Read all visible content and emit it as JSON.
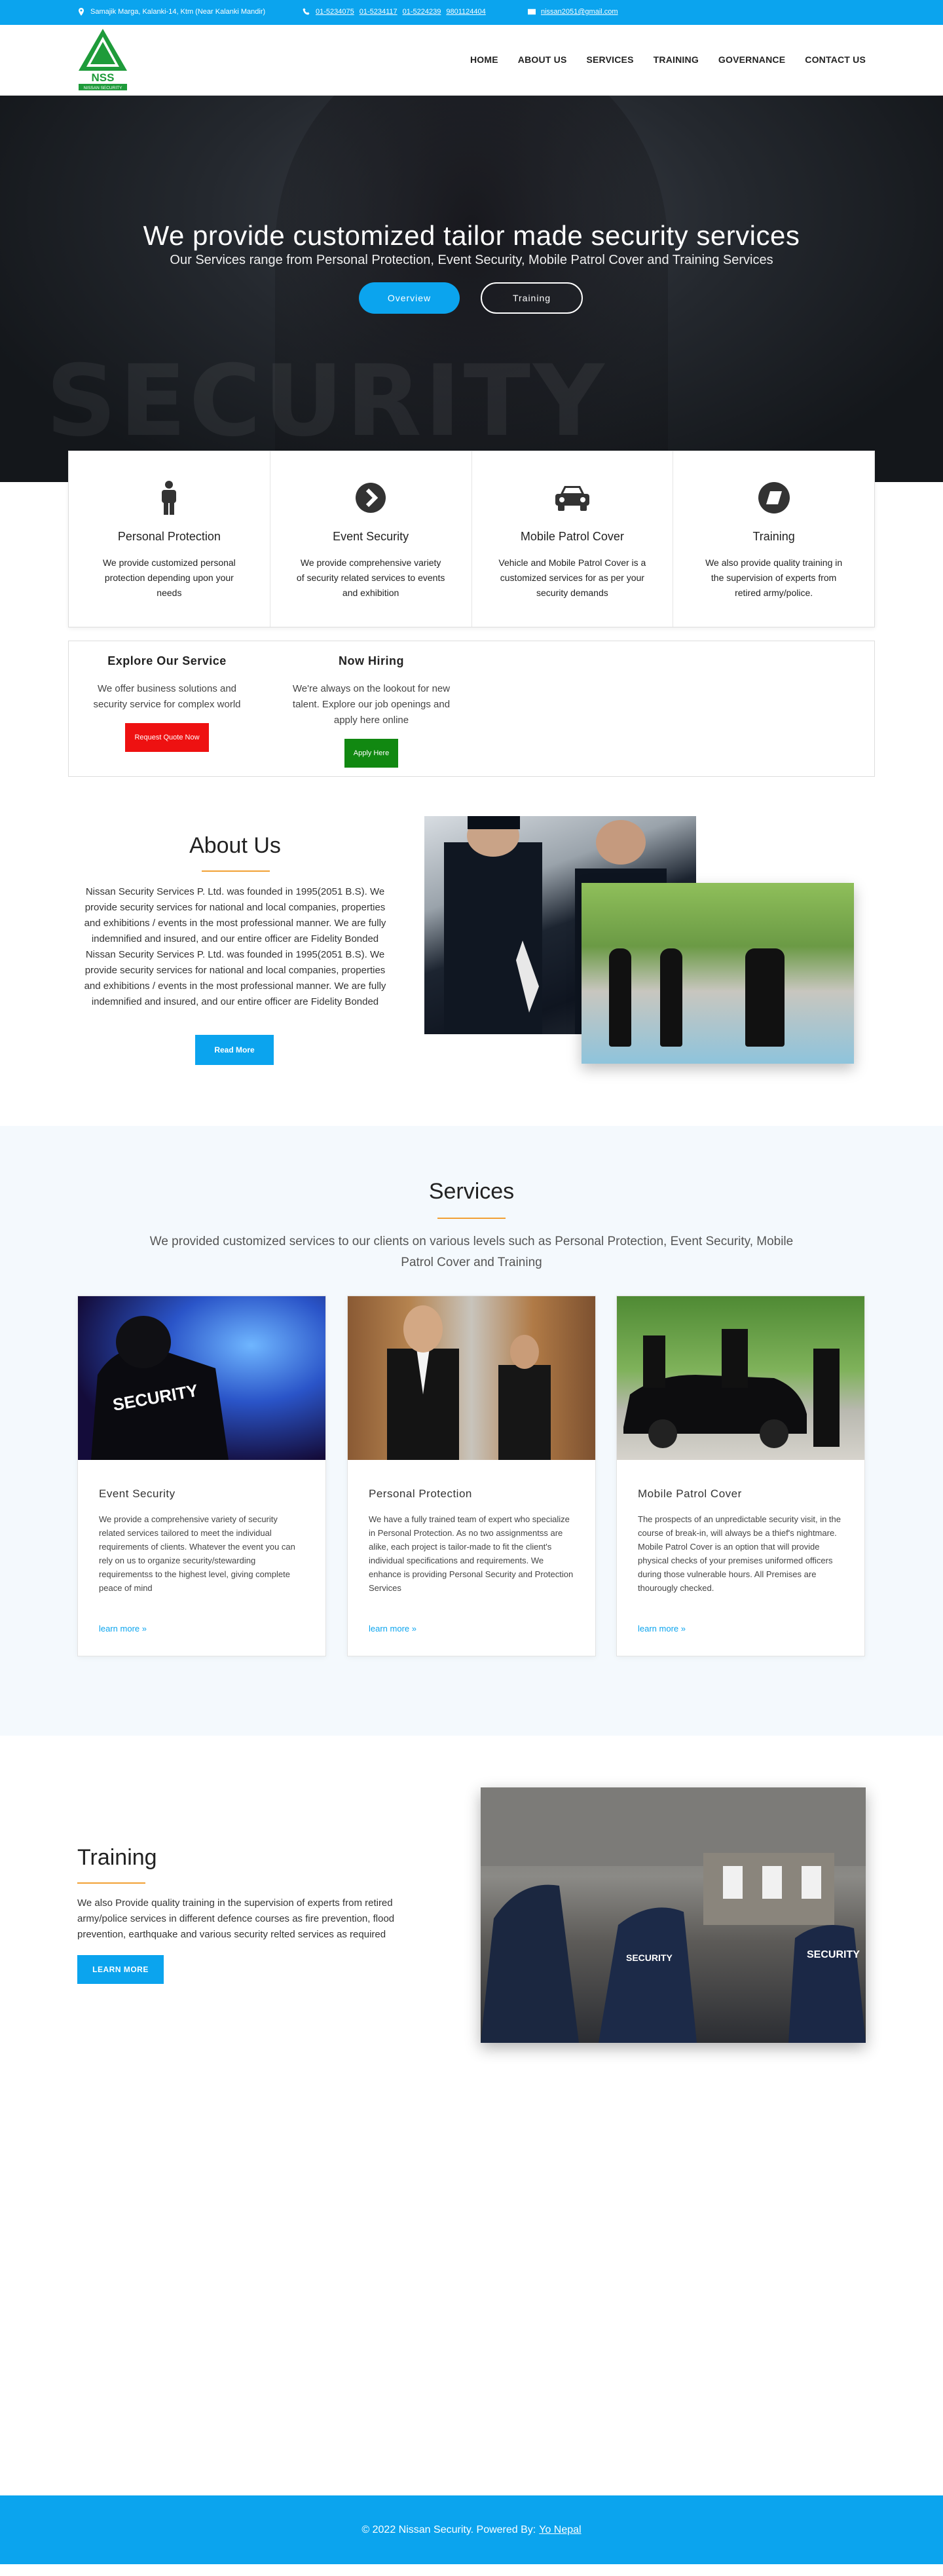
{
  "topbar": {
    "address": "Samajik Marga, Kalanki-14, Ktm (Near Kalanki Mandir)",
    "phones": [
      "01-5234075",
      "01-5234117",
      "01-5224239",
      "9801124404"
    ],
    "email": "nissan2051@gmail.com"
  },
  "logo": {
    "text": "NSS",
    "subtext": "NISSAN SECURITY"
  },
  "nav": [
    "HOME",
    "ABOUT US",
    "SERVICES",
    "TRAINING",
    "GOVERNANCE",
    "CONTACT US"
  ],
  "hero": {
    "title": "We provide customized tailor made security services",
    "subtitle": "Our Services range from Personal Protection, Event Security, Mobile Patrol Cover and Training Services",
    "overview_button": "Overview",
    "training_button": "Training",
    "background_text": "SECURITY"
  },
  "features": [
    {
      "icon": "person-icon",
      "title": "Personal Protection",
      "text": "We provide customized personal protection depending upon your needs"
    },
    {
      "icon": "chevron-circle-icon",
      "title": "Event Security",
      "text": "We provide comprehensive variety of security related services to events and exhibition"
    },
    {
      "icon": "car-icon",
      "title": "Mobile Patrol Cover",
      "text": "Vehicle and Mobile Patrol Cover is a customized services for as per your security demands"
    },
    {
      "icon": "eraser-icon",
      "title": "Training",
      "text": "We also provide quality training in the supervision of experts from retired army/police."
    }
  ],
  "explore": {
    "title": "Explore Our Service",
    "text": "We offer business solutions and security service for complex world",
    "button": "Request Quote Now",
    "button_color": "#ee1111"
  },
  "hiring": {
    "title": "Now Hiring",
    "text": "We're always on the lookout for new talent. Explore our job openings and apply here online",
    "button": "Apply Here",
    "button_color": "#118811"
  },
  "about": {
    "title": "About Us",
    "text": "Nissan Security Services P. Ltd. was founded in 1995(2051 B.S). We provide security services for national and local companies, properties and exhibitions / events in the most professional manner. We are fully indemnified and insured, and our entire officer are Fidelity Bonded Nissan Security Services P. Ltd. was founded in 1995(2051 B.S). We provide security services for national and local companies, properties and exhibitions / events in the most professional manner. We are fully indemnified and insured, and our entire officer are Fidelity Bonded",
    "button": "Read More"
  },
  "services": {
    "title": "Services",
    "text": "We provided customized services to our clients on various levels such as Personal Protection, Event Security, Mobile Patrol Cover and Training",
    "cards": [
      {
        "title": "Event Security",
        "image_text": "SECURITY",
        "text": "We provide a comprehensive variety of security related services tailored to meet the individual requirements of clients. Whatever the event you can rely on us to organize security/stewarding requirementss to the highest level, giving complete peace of mind",
        "link": "learn more"
      },
      {
        "title": "Personal Protection",
        "text": "We have a fully trained team of expert who specialize in Personal Protection. As no two assignmentss are alike, each project is tailor-made to fit the client's individual specifications and requirements. We enhance is providing Personal Security and Protection Services",
        "link": "learn more"
      },
      {
        "title": "Mobile Patrol Cover",
        "text": "The prospects of an unpredictable security visit, in the course of break-in, will always be a thief's nightmare. Mobile Patrol Cover is an option that will provide physical checks of your premises uniformed officers during those vulnerable hours.  All Premises are thourougly checked.",
        "link": "learn more"
      }
    ]
  },
  "training": {
    "title": "Training",
    "text": "We also Provide quality training in the supervision of experts from retired army/police services in different defence courses as fire prevention, flood prevention, earthquake and various security relted services as required",
    "button": "LEARN MORE",
    "image_text_1": "SECURITY",
    "image_text_2": "SECURITY"
  },
  "footer": {
    "text": "© 2022 Nissan Security. Powered By:",
    "link": "Yo Nepal"
  },
  "colors": {
    "accent": "#0ba4ee",
    "underline": "#f2a033",
    "logo_green": "#1e9b3a"
  }
}
